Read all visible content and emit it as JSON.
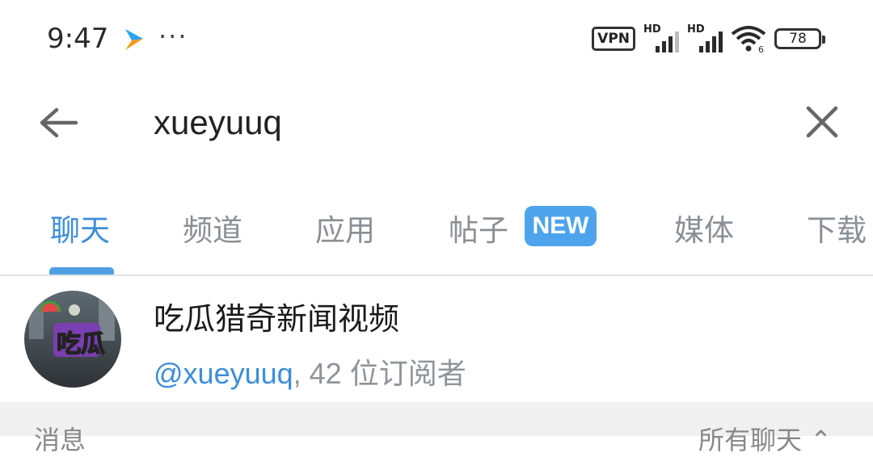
{
  "status": {
    "time": "9:47",
    "more": "···",
    "vpn": "VPN",
    "hd1": "HD",
    "hd2": "HD",
    "wifi_sub": "6",
    "battery": "78"
  },
  "search": {
    "query": "xueyuuq"
  },
  "tabs": [
    {
      "label": "聊天",
      "active": true
    },
    {
      "label": "频道",
      "active": false
    },
    {
      "label": "应用",
      "active": false
    },
    {
      "label": "帖子",
      "active": false
    },
    {
      "label": "媒体",
      "active": false
    },
    {
      "label": "下载",
      "active": false
    }
  ],
  "badge": {
    "label": "NEW"
  },
  "result": {
    "avatar_text": "吃瓜",
    "title": "吃瓜猎奇新闻视频",
    "handle": "@xueyuuq",
    "subscribers": ", 42 位订阅者"
  },
  "section": {
    "left_label": "消息",
    "right_label": "所有聊天 ⌃"
  },
  "colors": {
    "accent": "#3d8ed8",
    "badge": "#4ea4ec",
    "muted": "#8a8f94"
  }
}
